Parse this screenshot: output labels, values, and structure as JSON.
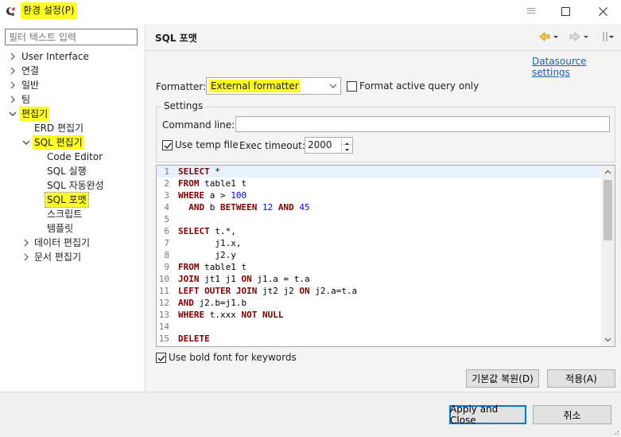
{
  "window": {
    "title": "환경 설정(P)",
    "icons": {
      "app": "eclipse-app-icon",
      "pin": "pin-icon",
      "maximize": "maximize-icon",
      "close": "close-icon"
    }
  },
  "colors": {
    "highlight": "#ffff22",
    "link": "#1a5fb4",
    "keyword": "#7f0000",
    "number": "#0000ff",
    "focus": "#0078d7"
  },
  "sidebar": {
    "filter_placeholder": "필터 텍스트 입력",
    "items": [
      {
        "label": "User Interface",
        "expanded": false,
        "highlighted": false
      },
      {
        "label": "연결",
        "expanded": false,
        "highlighted": false
      },
      {
        "label": "일반",
        "expanded": false,
        "highlighted": false
      },
      {
        "label": "팀",
        "expanded": false,
        "highlighted": false
      },
      {
        "label": "편집기",
        "expanded": true,
        "highlighted": true
      },
      {
        "label": "ERD 편집기",
        "highlighted": false
      },
      {
        "label": "SQL 편집기",
        "expanded": true,
        "highlighted": true
      },
      {
        "label": "Code Editor",
        "highlighted": false
      },
      {
        "label": "SQL 실행",
        "highlighted": false
      },
      {
        "label": "SQL 자동완성",
        "highlighted": false
      },
      {
        "label": "SQL 포맷",
        "highlighted": true,
        "selected": true
      },
      {
        "label": "스크립트",
        "highlighted": false
      },
      {
        "label": "템플릿",
        "highlighted": false
      },
      {
        "label": "데이터 편집기",
        "expanded": false,
        "highlighted": false
      },
      {
        "label": "문서 편집기",
        "expanded": false,
        "highlighted": false
      }
    ]
  },
  "page": {
    "title": "SQL 포맷",
    "nav_icons": [
      "back-arrow-icon",
      "back-menu-icon",
      "forward-arrow-icon",
      "forward-menu-icon",
      "view-menu-icon"
    ],
    "datasource_link": "Datasource settings",
    "formatter_label": "Formatter:",
    "formatter_value": "External formatter",
    "format_active_label": "Format active query only",
    "format_active_checked": false,
    "settings": {
      "title": "Settings",
      "command_line_label": "Command line:",
      "command_line_value": "",
      "use_temp_file_label": "Use temp file",
      "use_temp_file_checked": true,
      "exec_timeout_label": "Exec timeout:",
      "exec_timeout_value": "2000"
    },
    "preview_lines": [
      {
        "n": "1",
        "tokens": [
          [
            "kw",
            "SELECT"
          ],
          [
            "txt",
            " *"
          ]
        ]
      },
      {
        "n": "2",
        "tokens": [
          [
            "kw",
            "FROM"
          ],
          [
            "txt",
            " table1 t"
          ]
        ]
      },
      {
        "n": "3",
        "tokens": [
          [
            "kw",
            "WHERE"
          ],
          [
            "txt",
            " a > "
          ],
          [
            "num",
            "100"
          ]
        ]
      },
      {
        "n": "4",
        "tokens": [
          [
            "txt",
            "  "
          ],
          [
            "kw",
            "AND"
          ],
          [
            "txt",
            " b "
          ],
          [
            "kw",
            "BETWEEN"
          ],
          [
            "txt",
            " "
          ],
          [
            "num",
            "12"
          ],
          [
            "txt",
            " "
          ],
          [
            "kw",
            "AND"
          ],
          [
            "txt",
            " "
          ],
          [
            "num",
            "45"
          ]
        ]
      },
      {
        "n": "5",
        "tokens": []
      },
      {
        "n": "6",
        "tokens": [
          [
            "kw",
            "SELECT"
          ],
          [
            "txt",
            " t.*,"
          ]
        ]
      },
      {
        "n": "7",
        "tokens": [
          [
            "txt",
            "       j1.x,"
          ]
        ]
      },
      {
        "n": "8",
        "tokens": [
          [
            "txt",
            "       j2.y"
          ]
        ]
      },
      {
        "n": "9",
        "tokens": [
          [
            "kw",
            "FROM"
          ],
          [
            "txt",
            " table1 t"
          ]
        ]
      },
      {
        "n": "10",
        "tokens": [
          [
            "kw",
            "JOIN"
          ],
          [
            "txt",
            " jt1 j1 "
          ],
          [
            "kw",
            "ON"
          ],
          [
            "txt",
            " j1.a = t.a"
          ]
        ]
      },
      {
        "n": "11",
        "tokens": [
          [
            "kw",
            "LEFT OUTER JOIN"
          ],
          [
            "txt",
            " jt2 j2 "
          ],
          [
            "kw",
            "ON"
          ],
          [
            "txt",
            " j2.a=t.a"
          ]
        ]
      },
      {
        "n": "12",
        "tokens": [
          [
            "kw",
            "AND"
          ],
          [
            "txt",
            " j2.b=j1.b"
          ]
        ]
      },
      {
        "n": "13",
        "tokens": [
          [
            "kw",
            "WHERE"
          ],
          [
            "txt",
            " t.xxx "
          ],
          [
            "kw",
            "NOT NULL"
          ]
        ]
      },
      {
        "n": "14",
        "tokens": []
      },
      {
        "n": "15",
        "tokens": [
          [
            "kw",
            "DELETE"
          ]
        ]
      }
    ],
    "bold_keywords_label": "Use bold font for keywords",
    "bold_keywords_checked": true,
    "restore_defaults_label": "기본값 복원(D)",
    "apply_label": "적용(A)"
  },
  "footer": {
    "apply_close_label": "Apply and Close",
    "cancel_label": "취소"
  }
}
